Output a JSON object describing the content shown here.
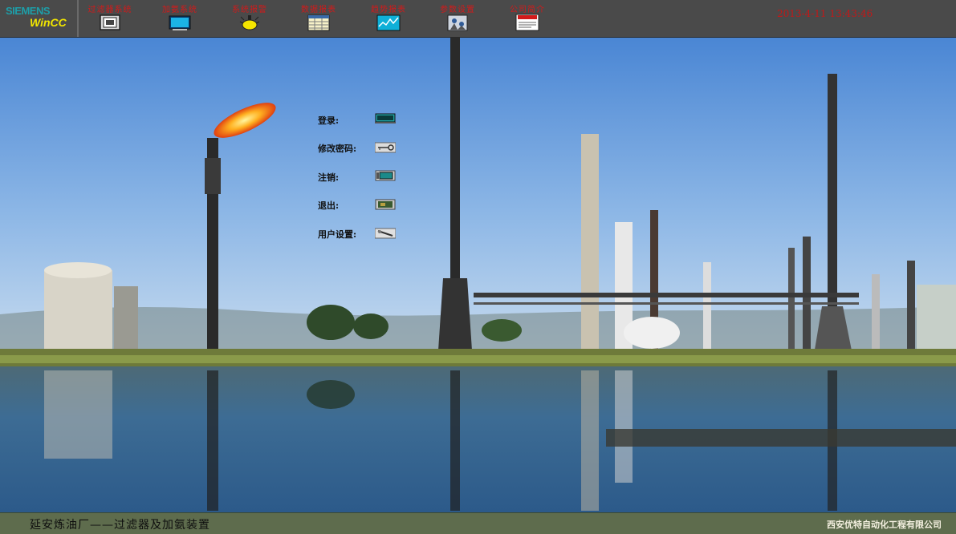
{
  "brand": {
    "siemens": "SIEMENS",
    "wincc": "WinCC"
  },
  "nav": [
    {
      "label": "过滤器系统",
      "icon": "filter-system-icon"
    },
    {
      "label": "加氨系统",
      "icon": "ammonia-system-icon"
    },
    {
      "label": "系统报警",
      "icon": "alarm-bulb-icon"
    },
    {
      "label": "数据报表",
      "icon": "data-report-icon"
    },
    {
      "label": "趋势报表",
      "icon": "trend-chart-icon"
    },
    {
      "label": "参数设置",
      "icon": "parameter-settings-icon"
    },
    {
      "label": "公司简介",
      "icon": "notice-icon"
    }
  ],
  "datetime": "2013-4-11 13:43:46",
  "login_menu": {
    "login": "登录:",
    "change_password": "修改密码:",
    "logout": "注销:",
    "exit": "退出:",
    "user_settings": "用户设置:"
  },
  "footer": {
    "plant": "延安炼油厂——过滤器及加氨装置",
    "company": "西安优特自动化工程有限公司"
  },
  "colors": {
    "topbar": "#4a4a4a",
    "nav_label": "#d21a1a",
    "datetime": "#c21818",
    "footer": "#5e6c4d"
  }
}
